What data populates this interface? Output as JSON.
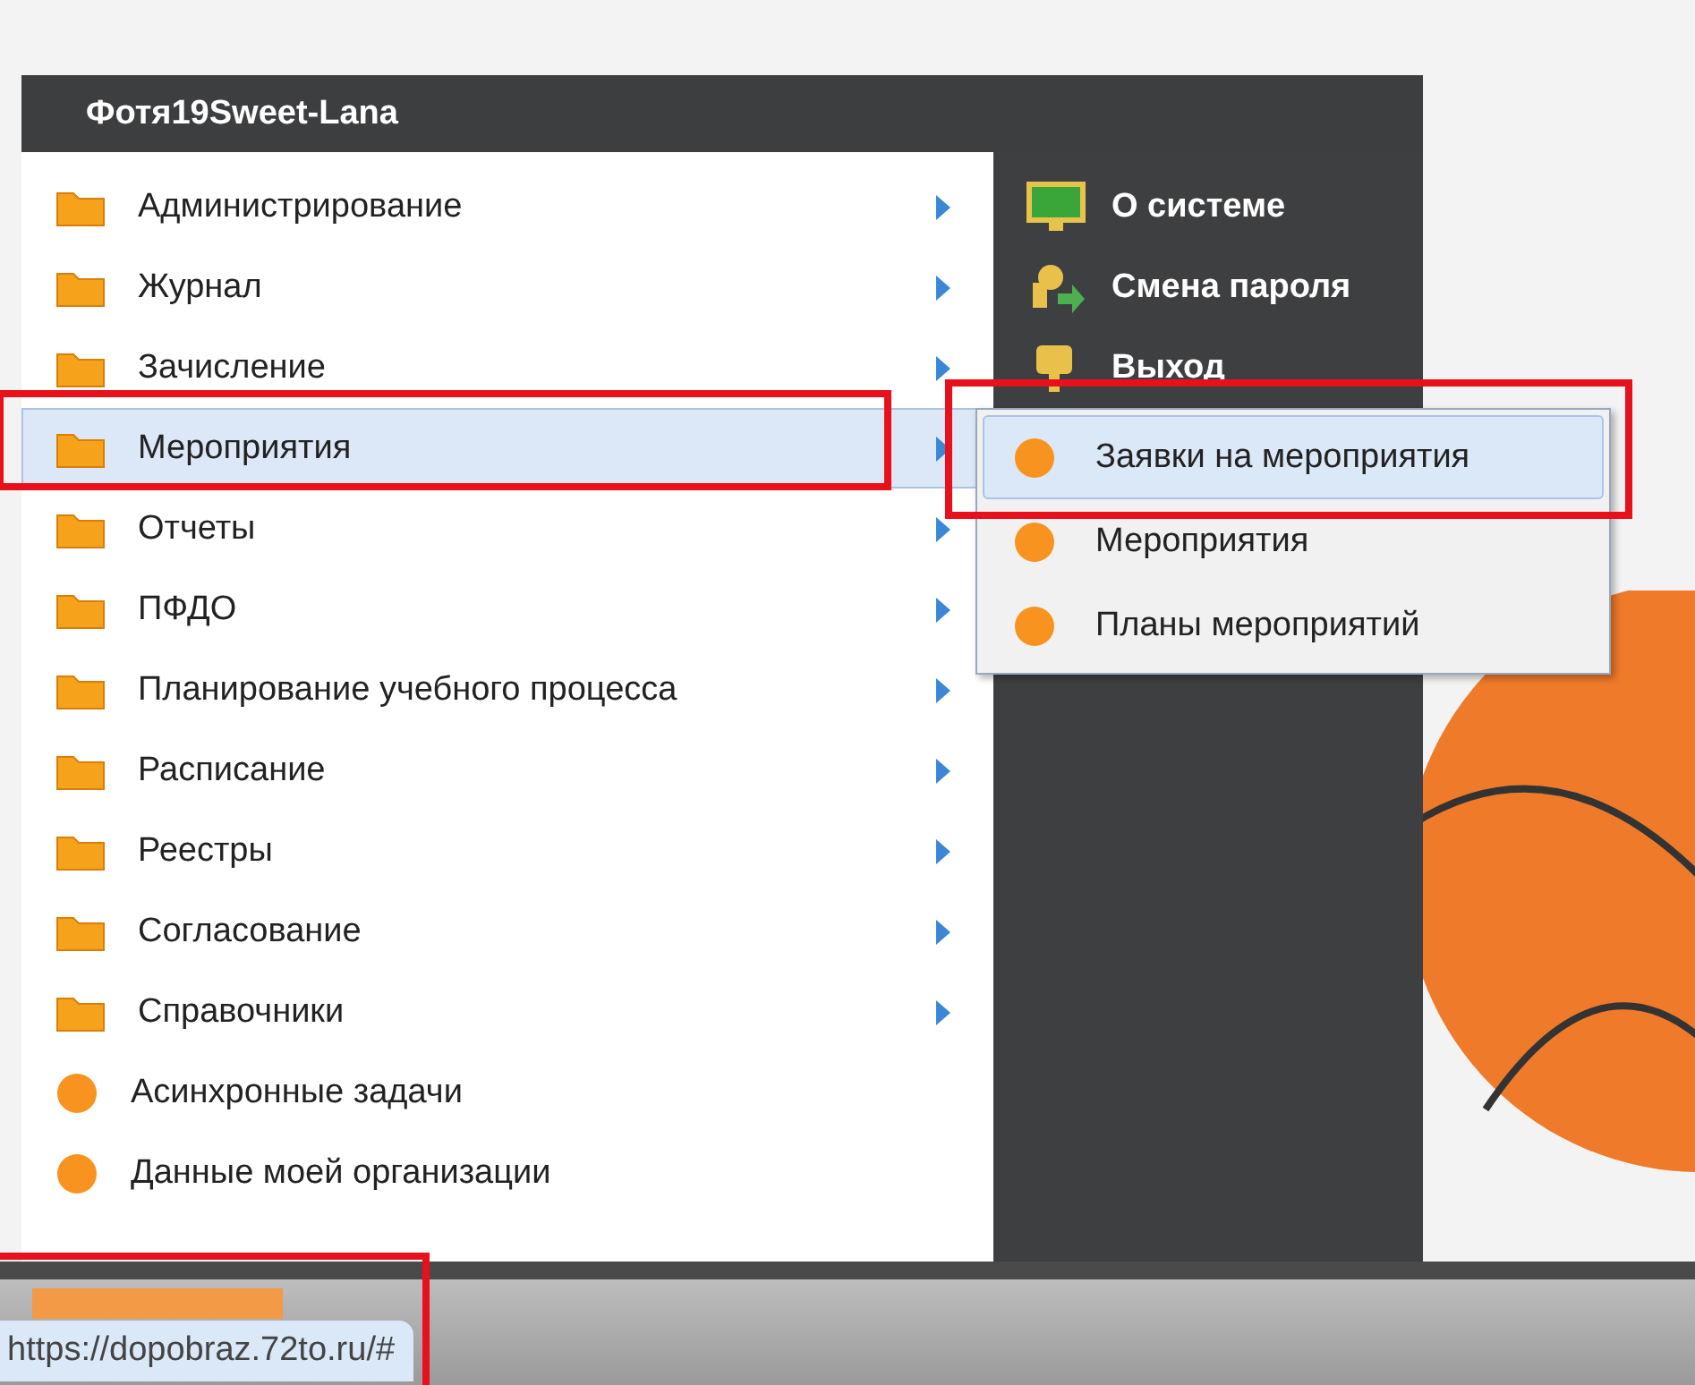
{
  "menu": {
    "user": "Фотя19Sweet-Lana",
    "items": [
      {
        "label": "Администрирование",
        "kind": "folder",
        "selected": false
      },
      {
        "label": "Журнал",
        "kind": "folder",
        "selected": false
      },
      {
        "label": "Зачисление",
        "kind": "folder",
        "selected": false
      },
      {
        "label": "Мероприятия",
        "kind": "folder",
        "selected": true
      },
      {
        "label": "Отчеты",
        "kind": "folder",
        "selected": false
      },
      {
        "label": "ПФДО",
        "kind": "folder",
        "selected": false
      },
      {
        "label": "Планирование учебного процесса",
        "kind": "folder",
        "selected": false
      },
      {
        "label": "Расписание",
        "kind": "folder",
        "selected": false
      },
      {
        "label": "Реестры",
        "kind": "folder",
        "selected": false
      },
      {
        "label": "Согласование",
        "kind": "folder",
        "selected": false
      },
      {
        "label": "Справочники",
        "kind": "folder",
        "selected": false
      },
      {
        "label": "Асинхронные задачи",
        "kind": "task",
        "selected": false
      },
      {
        "label": "Данные моей организации",
        "kind": "task",
        "selected": false
      }
    ],
    "actions": [
      {
        "label": "О системе",
        "kind": "info"
      },
      {
        "label": "Смена пароля",
        "kind": "password"
      },
      {
        "label": "Выход",
        "kind": "exit"
      }
    ]
  },
  "submenu": {
    "items": [
      {
        "label": "Заявки на мероприятия",
        "selected": true
      },
      {
        "label": "Мероприятия",
        "selected": false
      },
      {
        "label": "Планы мероприятий",
        "selected": false
      }
    ]
  },
  "status_url": "https://dopobraz.72to.ru/#"
}
